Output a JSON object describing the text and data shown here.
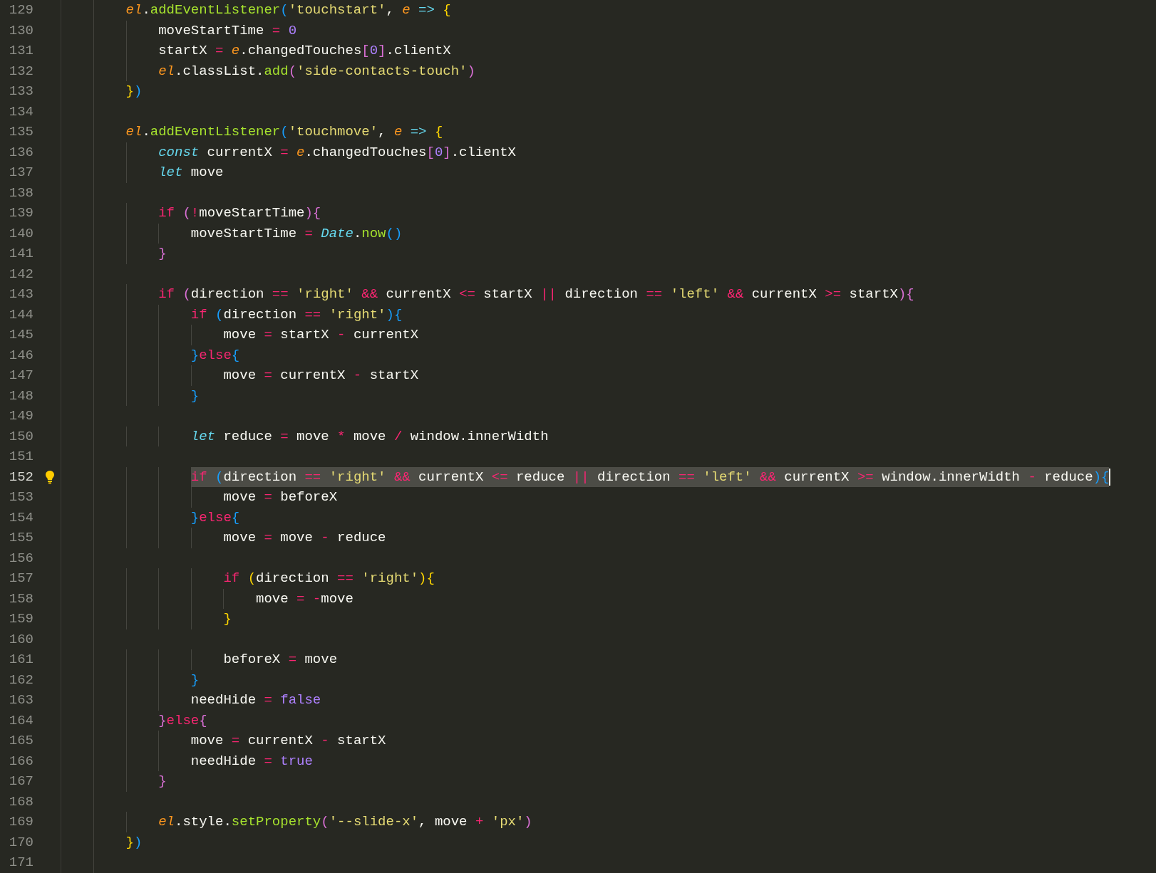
{
  "lines": [
    {
      "number": "129",
      "selected": false,
      "hint": false,
      "tokens": [
        {
          "kind": "v",
          "text": "    el"
        },
        {
          "kind": "p",
          "text": "."
        },
        {
          "kind": "f",
          "text": "addEventListener"
        },
        {
          "kind": "b3",
          "text": "("
        },
        {
          "kind": "s",
          "text": "'touchstart'"
        },
        {
          "kind": "p",
          "text": ","
        },
        {
          "kind": "v",
          "text": " e"
        },
        {
          "kind": "a",
          "text": " =>"
        },
        {
          "kind": "b1",
          "text": " {"
        }
      ]
    },
    {
      "number": "130",
      "selected": false,
      "hint": false,
      "tokens": [
        {
          "kind": "p",
          "text": "        moveStartTime"
        },
        {
          "kind": "o",
          "text": " ="
        },
        {
          "kind": "n",
          "text": " 0"
        }
      ]
    },
    {
      "number": "131",
      "selected": false,
      "hint": false,
      "tokens": [
        {
          "kind": "p",
          "text": "        startX"
        },
        {
          "kind": "o",
          "text": " ="
        },
        {
          "kind": "v",
          "text": " e"
        },
        {
          "kind": "p",
          "text": ".changedTouches"
        },
        {
          "kind": "b2",
          "text": "["
        },
        {
          "kind": "n",
          "text": "0"
        },
        {
          "kind": "b2",
          "text": "]"
        },
        {
          "kind": "p",
          "text": ".clientX"
        }
      ]
    },
    {
      "number": "132",
      "selected": false,
      "hint": false,
      "tokens": [
        {
          "kind": "v",
          "text": "        el"
        },
        {
          "kind": "p",
          "text": ".classList."
        },
        {
          "kind": "f",
          "text": "add"
        },
        {
          "kind": "b2",
          "text": "("
        },
        {
          "kind": "s",
          "text": "'side-contacts-touch'"
        },
        {
          "kind": "b2",
          "text": ")"
        }
      ]
    },
    {
      "number": "133",
      "selected": false,
      "hint": false,
      "tokens": [
        {
          "kind": "b1",
          "text": "    }"
        },
        {
          "kind": "b3",
          "text": ")"
        }
      ]
    },
    {
      "number": "134",
      "selected": false,
      "hint": false
    },
    {
      "number": "135",
      "selected": false,
      "hint": false,
      "tokens": [
        {
          "kind": "v",
          "text": "    el"
        },
        {
          "kind": "p",
          "text": "."
        },
        {
          "kind": "f",
          "text": "addEventListener"
        },
        {
          "kind": "b3",
          "text": "("
        },
        {
          "kind": "s",
          "text": "'touchmove'"
        },
        {
          "kind": "p",
          "text": ","
        },
        {
          "kind": "v",
          "text": " e"
        },
        {
          "kind": "a",
          "text": " =>"
        },
        {
          "kind": "b1",
          "text": " {"
        }
      ]
    },
    {
      "number": "136",
      "selected": false,
      "hint": false,
      "tokens": [
        {
          "kind": "t",
          "text": "        const"
        },
        {
          "kind": "p",
          "text": " currentX"
        },
        {
          "kind": "o",
          "text": " ="
        },
        {
          "kind": "v",
          "text": " e"
        },
        {
          "kind": "p",
          "text": ".changedTouches"
        },
        {
          "kind": "b2",
          "text": "["
        },
        {
          "kind": "n",
          "text": "0"
        },
        {
          "kind": "b2",
          "text": "]"
        },
        {
          "kind": "p",
          "text": ".clientX"
        }
      ]
    },
    {
      "number": "137",
      "selected": false,
      "hint": false,
      "tokens": [
        {
          "kind": "t",
          "text": "        let"
        },
        {
          "kind": "p",
          "text": " move"
        }
      ]
    },
    {
      "number": "138",
      "selected": false,
      "hint": false
    },
    {
      "number": "139",
      "selected": false,
      "hint": false,
      "tokens": [
        {
          "kind": "k",
          "text": "        if"
        },
        {
          "kind": "b2",
          "text": " ("
        },
        {
          "kind": "o",
          "text": "!"
        },
        {
          "kind": "p",
          "text": "moveStartTime"
        },
        {
          "kind": "b2",
          "text": "){"
        }
      ]
    },
    {
      "number": "140",
      "selected": false,
      "hint": false,
      "tokens": [
        {
          "kind": "p",
          "text": "            moveStartTime"
        },
        {
          "kind": "o",
          "text": " ="
        },
        {
          "kind": "c",
          "text": " Date"
        },
        {
          "kind": "p",
          "text": "."
        },
        {
          "kind": "f",
          "text": "now"
        },
        {
          "kind": "b3",
          "text": "()"
        }
      ]
    },
    {
      "number": "141",
      "selected": false,
      "hint": false,
      "tokens": [
        {
          "kind": "b2",
          "text": "        }"
        }
      ]
    },
    {
      "number": "142",
      "selected": false,
      "hint": false
    },
    {
      "number": "143",
      "selected": false,
      "hint": false,
      "tokens": [
        {
          "kind": "k",
          "text": "        if"
        },
        {
          "kind": "b2",
          "text": " ("
        },
        {
          "kind": "p",
          "text": "direction"
        },
        {
          "kind": "o",
          "text": " =="
        },
        {
          "kind": "s",
          "text": " 'right'"
        },
        {
          "kind": "o",
          "text": " &&"
        },
        {
          "kind": "p",
          "text": " currentX"
        },
        {
          "kind": "o",
          "text": " <="
        },
        {
          "kind": "p",
          "text": " startX"
        },
        {
          "kind": "o",
          "text": " ||"
        },
        {
          "kind": "p",
          "text": " direction"
        },
        {
          "kind": "o",
          "text": " =="
        },
        {
          "kind": "s",
          "text": " 'left'"
        },
        {
          "kind": "o",
          "text": " &&"
        },
        {
          "kind": "p",
          "text": " currentX"
        },
        {
          "kind": "o",
          "text": " >="
        },
        {
          "kind": "p",
          "text": " startX"
        },
        {
          "kind": "b2",
          "text": "){"
        }
      ]
    },
    {
      "number": "144",
      "selected": false,
      "hint": false,
      "tokens": [
        {
          "kind": "k",
          "text": "            if"
        },
        {
          "kind": "b3",
          "text": " ("
        },
        {
          "kind": "p",
          "text": "direction"
        },
        {
          "kind": "o",
          "text": " =="
        },
        {
          "kind": "s",
          "text": " 'right'"
        },
        {
          "kind": "b3",
          "text": "){"
        }
      ]
    },
    {
      "number": "145",
      "selected": false,
      "hint": false,
      "tokens": [
        {
          "kind": "p",
          "text": "                move"
        },
        {
          "kind": "o",
          "text": " ="
        },
        {
          "kind": "p",
          "text": " startX"
        },
        {
          "kind": "o",
          "text": " -"
        },
        {
          "kind": "p",
          "text": " currentX"
        }
      ]
    },
    {
      "number": "146",
      "selected": false,
      "hint": false,
      "tokens": [
        {
          "kind": "b3",
          "text": "            }"
        },
        {
          "kind": "k",
          "text": "else"
        },
        {
          "kind": "b3",
          "text": "{"
        }
      ]
    },
    {
      "number": "147",
      "selected": false,
      "hint": false,
      "tokens": [
        {
          "kind": "p",
          "text": "                move"
        },
        {
          "kind": "o",
          "text": " ="
        },
        {
          "kind": "p",
          "text": " currentX"
        },
        {
          "kind": "o",
          "text": " -"
        },
        {
          "kind": "p",
          "text": " startX"
        }
      ]
    },
    {
      "number": "148",
      "selected": false,
      "hint": false,
      "tokens": [
        {
          "kind": "b3",
          "text": "            }"
        }
      ]
    },
    {
      "number": "149",
      "selected": false,
      "hint": false
    },
    {
      "number": "150",
      "selected": false,
      "hint": false,
      "tokens": [
        {
          "kind": "t",
          "text": "            let"
        },
        {
          "kind": "p",
          "text": " reduce"
        },
        {
          "kind": "o",
          "text": " ="
        },
        {
          "kind": "p",
          "text": " move"
        },
        {
          "kind": "o",
          "text": " *"
        },
        {
          "kind": "p",
          "text": " move"
        },
        {
          "kind": "o",
          "text": " /"
        },
        {
          "kind": "p",
          "text": " window.innerWidth"
        }
      ]
    },
    {
      "number": "151",
      "selected": false,
      "hint": false
    },
    {
      "number": "152",
      "selected": true,
      "hint": true,
      "tokens": [
        {
          "kind": "k",
          "text": "            if"
        },
        {
          "kind": "b3",
          "text": " ("
        },
        {
          "kind": "p",
          "text": "direction"
        },
        {
          "kind": "o",
          "text": " =="
        },
        {
          "kind": "s",
          "text": " 'right'"
        },
        {
          "kind": "o",
          "text": " &&"
        },
        {
          "kind": "p",
          "text": " currentX"
        },
        {
          "kind": "o",
          "text": " <="
        },
        {
          "kind": "p",
          "text": " reduce"
        },
        {
          "kind": "o",
          "text": " ||"
        },
        {
          "kind": "p",
          "text": " direction"
        },
        {
          "kind": "o",
          "text": " =="
        },
        {
          "kind": "s",
          "text": " 'left'"
        },
        {
          "kind": "o",
          "text": " &&"
        },
        {
          "kind": "p",
          "text": " currentX"
        },
        {
          "kind": "o",
          "text": " >="
        },
        {
          "kind": "p",
          "text": " window.innerWidth"
        },
        {
          "kind": "o",
          "text": " -"
        },
        {
          "kind": "p",
          "text": " reduce"
        },
        {
          "kind": "b3",
          "text": "){"
        }
      ]
    },
    {
      "number": "153",
      "selected": false,
      "hint": false,
      "tokens": [
        {
          "kind": "p",
          "text": "                move"
        },
        {
          "kind": "o",
          "text": " ="
        },
        {
          "kind": "p",
          "text": " beforeX"
        }
      ]
    },
    {
      "number": "154",
      "selected": false,
      "hint": false,
      "tokens": [
        {
          "kind": "b3",
          "text": "            }"
        },
        {
          "kind": "k",
          "text": "else"
        },
        {
          "kind": "b3",
          "text": "{"
        }
      ]
    },
    {
      "number": "155",
      "selected": false,
      "hint": false,
      "tokens": [
        {
          "kind": "p",
          "text": "                move"
        },
        {
          "kind": "o",
          "text": " ="
        },
        {
          "kind": "p",
          "text": " move"
        },
        {
          "kind": "o",
          "text": " -"
        },
        {
          "kind": "p",
          "text": " reduce"
        }
      ]
    },
    {
      "number": "156",
      "selected": false,
      "hint": false
    },
    {
      "number": "157",
      "selected": false,
      "hint": false,
      "tokens": [
        {
          "kind": "k",
          "text": "                if"
        },
        {
          "kind": "b1",
          "text": " ("
        },
        {
          "kind": "p",
          "text": "direction"
        },
        {
          "kind": "o",
          "text": " =="
        },
        {
          "kind": "s",
          "text": " 'right'"
        },
        {
          "kind": "b1",
          "text": "){"
        }
      ]
    },
    {
      "number": "158",
      "selected": false,
      "hint": false,
      "tokens": [
        {
          "kind": "p",
          "text": "                    move"
        },
        {
          "kind": "o",
          "text": " ="
        },
        {
          "kind": "o",
          "text": " -"
        },
        {
          "kind": "p",
          "text": "move"
        }
      ]
    },
    {
      "number": "159",
      "selected": false,
      "hint": false,
      "tokens": [
        {
          "kind": "b1",
          "text": "                }"
        }
      ]
    },
    {
      "number": "160",
      "selected": false,
      "hint": false
    },
    {
      "number": "161",
      "selected": false,
      "hint": false,
      "tokens": [
        {
          "kind": "p",
          "text": "                beforeX"
        },
        {
          "kind": "o",
          "text": " ="
        },
        {
          "kind": "p",
          "text": " move"
        }
      ]
    },
    {
      "number": "162",
      "selected": false,
      "hint": false,
      "tokens": [
        {
          "kind": "b3",
          "text": "            }"
        }
      ]
    },
    {
      "number": "163",
      "selected": false,
      "hint": false,
      "tokens": [
        {
          "kind": "p",
          "text": "            needHide"
        },
        {
          "kind": "o",
          "text": " ="
        },
        {
          "kind": "n",
          "text": " false"
        }
      ]
    },
    {
      "number": "164",
      "selected": false,
      "hint": false,
      "tokens": [
        {
          "kind": "b2",
          "text": "        }"
        },
        {
          "kind": "k",
          "text": "else"
        },
        {
          "kind": "b2",
          "text": "{"
        }
      ]
    },
    {
      "number": "165",
      "selected": false,
      "hint": false,
      "tokens": [
        {
          "kind": "p",
          "text": "            move"
        },
        {
          "kind": "o",
          "text": " ="
        },
        {
          "kind": "p",
          "text": " currentX"
        },
        {
          "kind": "o",
          "text": " -"
        },
        {
          "kind": "p",
          "text": " startX"
        }
      ]
    },
    {
      "number": "166",
      "selected": false,
      "hint": false,
      "tokens": [
        {
          "kind": "p",
          "text": "            needHide"
        },
        {
          "kind": "o",
          "text": " ="
        },
        {
          "kind": "n",
          "text": " true"
        }
      ]
    },
    {
      "number": "167",
      "selected": false,
      "hint": false,
      "tokens": [
        {
          "kind": "b2",
          "text": "        }"
        }
      ]
    },
    {
      "number": "168",
      "selected": false,
      "hint": false
    },
    {
      "number": "169",
      "selected": false,
      "hint": false,
      "tokens": [
        {
          "kind": "v",
          "text": "        el"
        },
        {
          "kind": "p",
          "text": ".style."
        },
        {
          "kind": "f",
          "text": "setProperty"
        },
        {
          "kind": "b2",
          "text": "("
        },
        {
          "kind": "s",
          "text": "'--slide-x'"
        },
        {
          "kind": "p",
          "text": ", move"
        },
        {
          "kind": "o",
          "text": " +"
        },
        {
          "kind": "s",
          "text": " 'px'"
        },
        {
          "kind": "b2",
          "text": ")"
        }
      ]
    },
    {
      "number": "170",
      "selected": false,
      "hint": false,
      "tokens": [
        {
          "kind": "b1",
          "text": "    }"
        },
        {
          "kind": "b3",
          "text": ")"
        }
      ]
    },
    {
      "number": "171",
      "selected": false,
      "hint": false
    }
  ]
}
